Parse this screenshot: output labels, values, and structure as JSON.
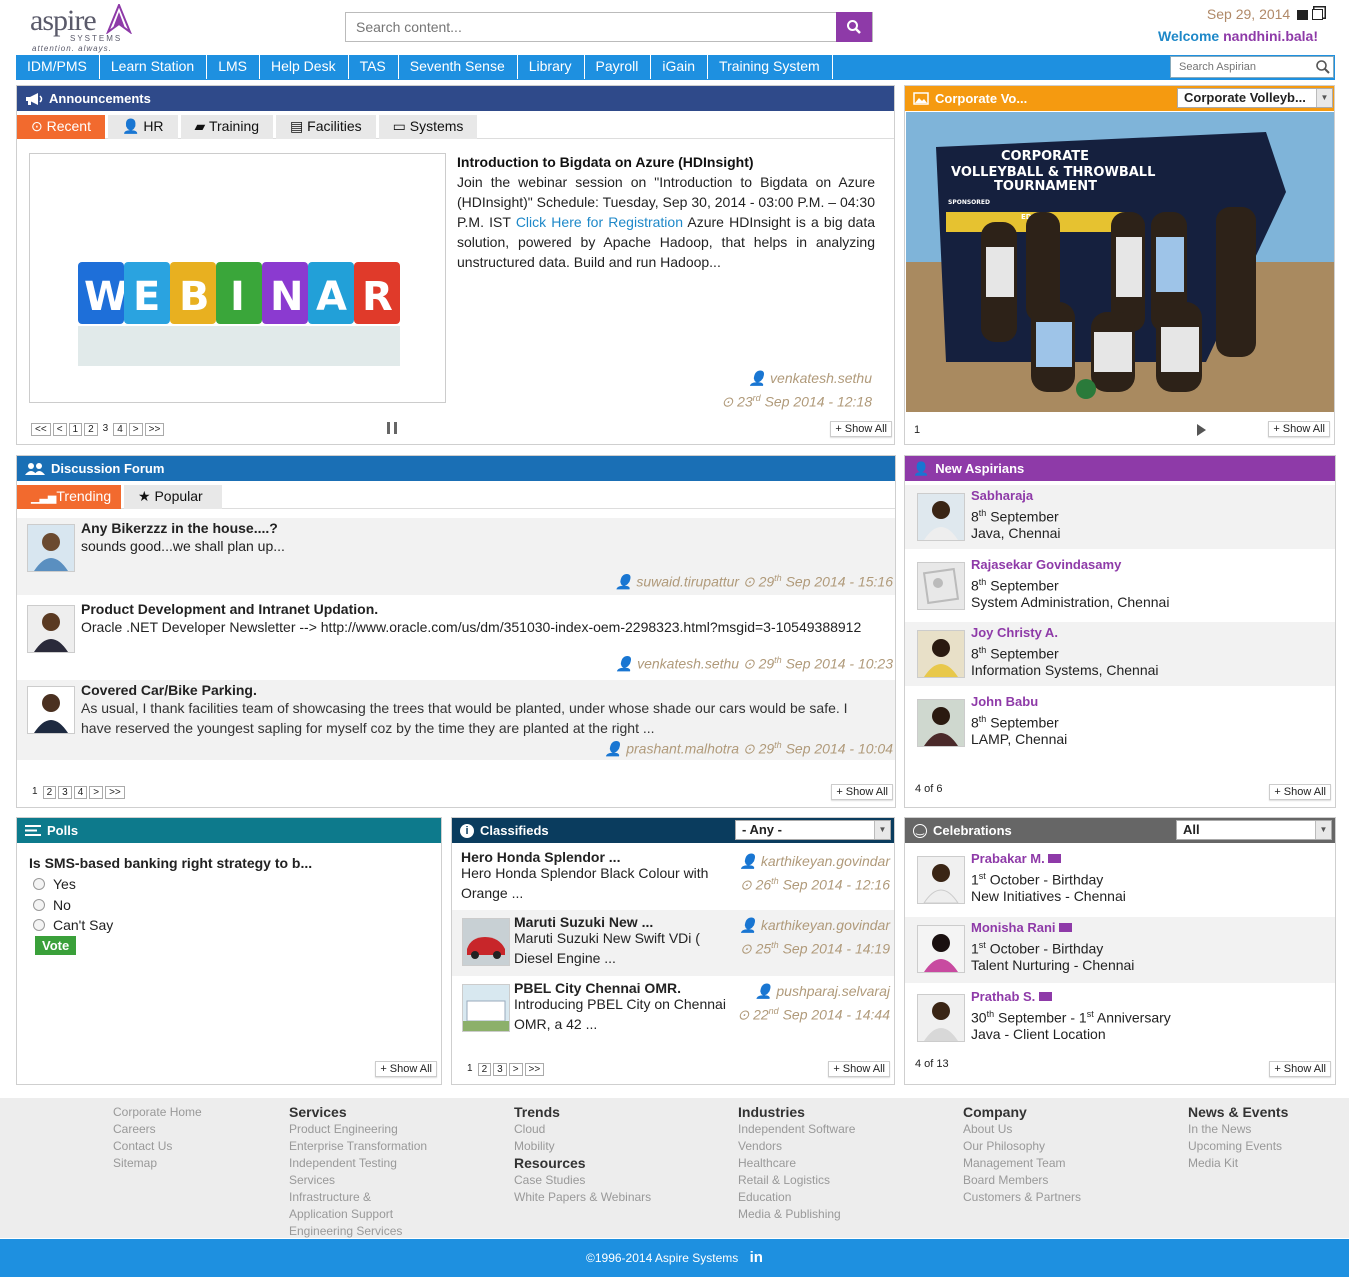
{
  "header": {
    "logo_word": "aspire",
    "logo_sub": "SYSTEMS",
    "logo_tag": "attention. always.",
    "search_placeholder": "Search content...",
    "date": "Sep 29, 2014",
    "welcome_label": "Welcome",
    "username": "nandhini.bala!"
  },
  "nav": {
    "items": [
      "IDM/PMS",
      "Learn Station",
      "LMS",
      "Help Desk",
      "TAS",
      "Seventh Sense",
      "Library",
      "Payroll",
      "iGain",
      "Training System"
    ],
    "search_placeholder": "Search Aspirian"
  },
  "announcements": {
    "title": "Announcements",
    "tabs": [
      "Recent",
      "HR",
      "Training",
      "Facilities",
      "Systems"
    ],
    "image_text": "WEBINAR",
    "post_title": "Introduction to Bigdata on Azure (HDInsight)",
    "post_body_1": "Join the webinar session on \"Introduction to Bigdata on Azure (HDInsight)\" Schedule: Tuesday, Sep 30, 2014 - 03:00 P.M. – 04:30 P.M. IST ",
    "post_link": "Click Here for Registration",
    "post_body_2": " Azure HDInsight is a big data solution, powered by Apache Hadoop, that helps in analyzing unstructured data. Build and run Hadoop...",
    "author": "venkatesh.sethu",
    "date_day": "23",
    "date_sup": "rd",
    "date_rest": "Sep 2014 - 12:18",
    "pager": [
      "<<",
      "<",
      "1",
      "2",
      "3",
      "4",
      ">",
      ">>"
    ],
    "current_page": "3",
    "show_all": "Show All"
  },
  "corporate": {
    "title": "Corporate Vo...",
    "select": "Corporate Volleyb...",
    "photo_text_1": "CORPORATE",
    "photo_text_2": "VOLLEYBALL & THROWBALL",
    "photo_text_3": "TOURNAMENT",
    "photo_text_4": "SPONSORED",
    "photo_text_5": "EDEN",
    "counter": "1",
    "show_all": "Show All"
  },
  "forum": {
    "title": "Discussion Forum",
    "tabs": [
      "Trending",
      "Popular"
    ],
    "posts": [
      {
        "title": "Any Bikerzzz in the house....?",
        "body": "sounds good...we shall plan up...",
        "author": "suwaid.tirupattur",
        "day": "29",
        "sup": "th",
        "rest": "Sep 2014 - 15:16"
      },
      {
        "title": "Product Development and Intranet Updation.",
        "body": "Oracle .NET Developer Newsletter --> http://www.oracle.com/us/dm/351030-index-oem-2298323.html?msgid=3-10549388912",
        "author": "venkatesh.sethu",
        "day": "29",
        "sup": "th",
        "rest": "Sep 2014 - 10:23"
      },
      {
        "title": "Covered Car/Bike Parking.",
        "body": "As usual, I thank facilities team of showcasing the trees that would be planted, under whose shade our cars would be safe. I have reserved the youngest sapling for myself coz by the time they are planted at the right ...",
        "author": "prashant.malhotra",
        "day": "29",
        "sup": "th",
        "rest": "Sep 2014 - 10:04"
      }
    ],
    "pager": [
      "1",
      "2",
      "3",
      "4",
      ">",
      ">>"
    ],
    "show_all": "Show All"
  },
  "new_aspirians": {
    "title": "New Aspirians",
    "people": [
      {
        "name": "Sabharaja",
        "day": "8",
        "sup": "th",
        "month": "September",
        "dept": "Java, Chennai"
      },
      {
        "name": "Rajasekar Govindasamy",
        "day": "8",
        "sup": "th",
        "month": "September",
        "dept": "System Administration, Chennai"
      },
      {
        "name": "Joy Christy A.",
        "day": "8",
        "sup": "th",
        "month": "September",
        "dept": "Information Systems, Chennai"
      },
      {
        "name": "John Babu",
        "day": "8",
        "sup": "th",
        "month": "September",
        "dept": "LAMP, Chennai"
      }
    ],
    "count": "4 of 6",
    "show_all": "Show All"
  },
  "polls": {
    "title": "Polls",
    "question": "Is SMS-based banking right strategy to b...",
    "options": [
      "Yes",
      "No",
      "Can't Say"
    ],
    "vote": "Vote",
    "show_all": "Show All"
  },
  "classifieds": {
    "title": "Classifieds",
    "select": "- Any -",
    "items": [
      {
        "title": "Hero Honda Splendor ...",
        "body": "Hero Honda Splendor Black Colour with Orange ...",
        "author": "karthikeyan.govindar",
        "day": "26",
        "sup": "th",
        "rest": "Sep 2014 - 12:16"
      },
      {
        "title": "Maruti Suzuki New ...",
        "body": "Maruti Suzuki New Swift VDi ( Diesel Engine ...",
        "author": "karthikeyan.govindar",
        "day": "25",
        "sup": "th",
        "rest": "Sep 2014 - 14:19"
      },
      {
        "title": "PBEL City Chennai OMR.",
        "body": "Introducing PBEL City on Chennai OMR, a 42 ...",
        "author": "pushparaj.selvaraj",
        "day": "22",
        "sup": "nd",
        "rest": "Sep 2014 - 14:44"
      }
    ],
    "pager": [
      "1",
      "2",
      "3",
      ">",
      ">>"
    ],
    "show_all": "Show All"
  },
  "celebrations": {
    "title": "Celebrations",
    "select": "All",
    "people": [
      {
        "name": "Prabakar M.",
        "d1": "1",
        "s1": "st",
        "m1": "October - Birthday",
        "d2": "",
        "s2": "",
        "m2": "",
        "dept": "New Initiatives - Chennai"
      },
      {
        "name": "Monisha Rani",
        "d1": "1",
        "s1": "st",
        "m1": "October - Birthday",
        "d2": "",
        "s2": "",
        "m2": "",
        "dept": "Talent Nurturing - Chennai"
      },
      {
        "name": "Prathab S.",
        "d1": "30",
        "s1": "th",
        "m1": "September - ",
        "d2": "1",
        "s2": "st",
        "m2": "Anniversary",
        "dept": "Java - Client Location"
      }
    ],
    "count": "4 of 13",
    "show_all": "Show All"
  },
  "footer": {
    "col1": [
      "Corporate Home",
      "Careers",
      "Contact Us",
      "Sitemap"
    ],
    "services_h": "Services",
    "services": [
      "Product Engineering",
      "Enterprise Transformation",
      "Independent Testing",
      "Services",
      "Infrastructure &",
      "Application Support",
      "Engineering Services"
    ],
    "trends_h": "Trends",
    "trends": [
      "Cloud",
      "Mobility"
    ],
    "resources_h": "Resources",
    "resources": [
      "Case Studies",
      "White Papers & Webinars"
    ],
    "industries_h": "Industries",
    "industries": [
      "Independent Software",
      "Vendors",
      "Healthcare",
      "Retail & Logistics",
      "Education",
      "Media & Publishing"
    ],
    "company_h": "Company",
    "company": [
      "About Us",
      "Our Philosophy",
      "Management Team",
      "Board Members",
      "Customers & Partners"
    ],
    "news_h": "News & Events",
    "news": [
      "In the News",
      "Upcoming Events",
      "Media Kit"
    ],
    "copyright": "©1996-2014 Aspire Systems",
    "linkedin": "in"
  },
  "colors": {
    "nav_blue": "#1e90e0",
    "purple": "#8e3aa8",
    "orange": "#f26a2e",
    "announce_head": "#2f4a8a",
    "forum_head": "#1a6fb5",
    "corporate_head": "#f59a10",
    "aspirians_head": "#8e3aa8",
    "polls_head": "#0d7a8c",
    "classifieds_head": "#0a3c5e",
    "celebrations_head": "#666666"
  }
}
